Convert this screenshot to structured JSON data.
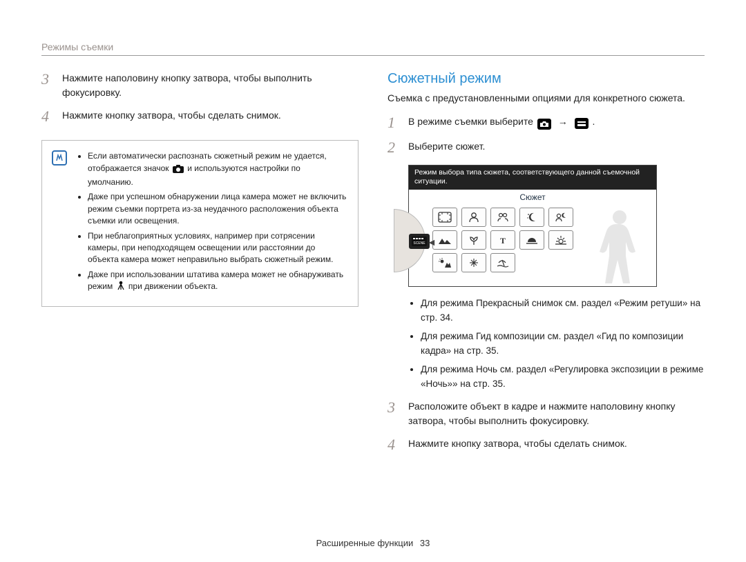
{
  "header": {
    "title": "Режимы съемки"
  },
  "left": {
    "steps": [
      {
        "n": "3",
        "text": "Нажмите наполовину кнопку затвора, чтобы выполнить фокусировку."
      },
      {
        "n": "4",
        "text": "Нажмите кнопку затвора, чтобы сделать снимок."
      }
    ],
    "info_items": [
      "Если автоматически распознать сюжетный режим не удается, отображается значок    и используются настройки по умолчанию.",
      "Даже при успешном обнаружении лица камера может не включить режим съемки портрета из-за неудачного расположения объекта съемки или освещения.",
      "При неблагоприятных условиях, например при сотрясении камеры, при неподходящем освещении или расстоянии до объекта камера может неправильно выбрать сюжетный режим.",
      "Даже при использовании штатива камера может не обнаруживать режим    при движении объекта."
    ],
    "info_icon_label": "i"
  },
  "right": {
    "heading": "Сюжетный режим",
    "desc": "Съемка с предустановленными опциями для конкретного сюжета.",
    "step1_prefix": "В режиме съемки выберите ",
    "step1_suffix": ".",
    "step2": "Выберите сюжет.",
    "device": {
      "hint": "Режим выбора типа сюжета, соответствующего данной съемочной ситуации.",
      "title": "Сюжет",
      "scene_chip": "SCENE"
    },
    "scene_icons": [
      "frame",
      "portrait",
      "children",
      "night",
      "closeup-portrait",
      "landscape",
      "macro",
      "text",
      "sunset",
      "dawn",
      "backlight",
      "fireworks",
      "beach"
    ],
    "bullets": [
      "Для режима Прекрасный снимок см. раздел «Режим ретуши» на стр. 34.",
      "Для режима Гид композиции см. раздел «Гид по композиции кадра» на стр. 35.",
      "Для режима Ночь см. раздел «Регулировка экспозиции в режиме «Ночь»» на стр. 35."
    ],
    "step3": "Расположите объект в кадре и нажмите наполовину кнопку затвора, чтобы выполнить фокусировку.",
    "step4": "Нажмите кнопку затвора, чтобы сделать снимок."
  },
  "footer": {
    "label": "Расширенные функции",
    "page": "33"
  }
}
